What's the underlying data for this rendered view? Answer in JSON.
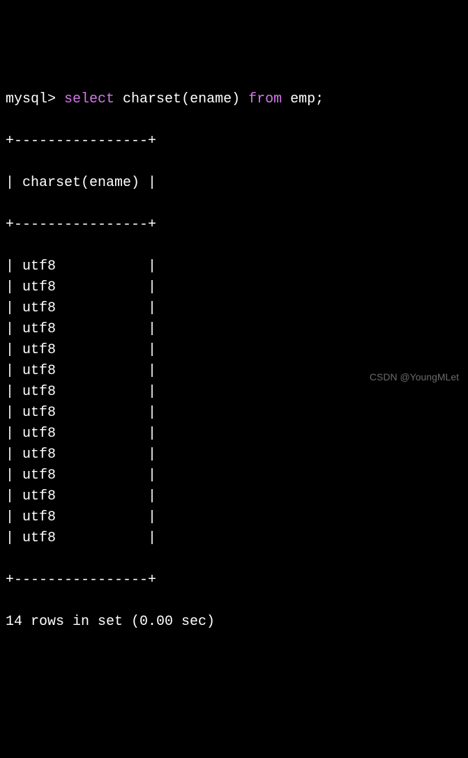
{
  "prompt": "mysql>",
  "query": {
    "select_kw": "select",
    "func_part": " charset(ename) ",
    "from_kw": "from",
    "table_part": " emp;"
  },
  "table": {
    "border": "+----------------+",
    "header_left": "| ",
    "header_text": "charset(ename)",
    "header_right": " |",
    "rows": [
      "utf8",
      "utf8",
      "utf8",
      "utf8",
      "utf8",
      "utf8",
      "utf8",
      "utf8",
      "utf8",
      "utf8",
      "utf8",
      "utf8",
      "utf8",
      "utf8"
    ],
    "row_left": "| ",
    "row_pad": "           |"
  },
  "status": "14 rows in set (0.00 sec)",
  "watermark": "CSDN @YoungMLet"
}
